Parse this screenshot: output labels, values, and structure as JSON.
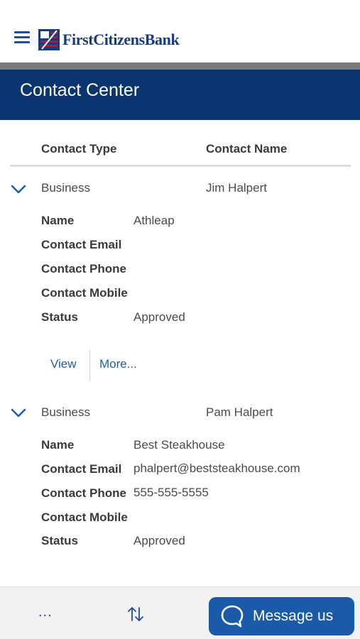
{
  "header": {
    "brand": "FirstCitizensBank",
    "menu_icon": "hamburger-menu-icon",
    "logo_icon": "bank-flag-logo-icon"
  },
  "page": {
    "title": "Contact Center"
  },
  "table": {
    "columns": [
      "Contact Type",
      "Contact Name"
    ]
  },
  "records": [
    {
      "type": "Business",
      "name": "Jim Halpert",
      "details": {
        "name_label": "Name",
        "name_value": "Athleap",
        "email_label": "Contact Email",
        "email_value": "",
        "phone_label": "Contact Phone",
        "phone_value": "",
        "mobile_label": "Contact Mobile",
        "mobile_value": "",
        "status_label": "Status",
        "status_value": "Approved"
      },
      "actions": {
        "view": "View",
        "more": "More..."
      }
    },
    {
      "type": "Business",
      "name": "Pam Halpert",
      "details": {
        "name_label": "Name",
        "name_value": "Best Steakhouse",
        "email_label": "Contact Email",
        "email_value": "phalpert@beststeakhouse.com",
        "phone_label": "Contact Phone",
        "phone_value": "555-555-5555",
        "mobile_label": "Contact Mobile",
        "mobile_value": "",
        "status_label": "Status",
        "status_value": "Approved"
      }
    }
  ],
  "bottom_bar": {
    "more_label": "...",
    "sort_icon": "sort-arrows-icon",
    "message_label": "Message us",
    "message_icon": "chat-bubble-icon"
  },
  "colors": {
    "brand_navy": "#0a3570",
    "link_blue": "#1f5fa8",
    "button_blue": "#1a5aa8"
  }
}
